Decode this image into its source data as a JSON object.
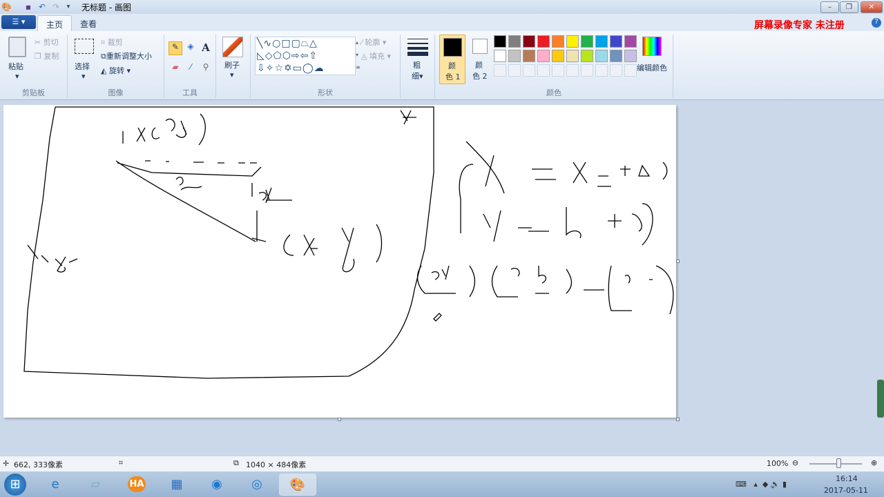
{
  "window": {
    "title": "无标题 - 画图",
    "watermark": "屏幕录像专家  未注册"
  },
  "tabs": [
    {
      "label": "主页",
      "active": true
    },
    {
      "label": "查看",
      "active": false
    }
  ],
  "ribbon": {
    "clipboard": {
      "paste": "粘贴",
      "cut": "剪切",
      "copy": "复制",
      "group": "剪贴板"
    },
    "image": {
      "select": "选择",
      "crop": "裁剪",
      "resize": "重新调整大小",
      "rotate": "旋转",
      "group": "图像"
    },
    "tools": {
      "group": "工具",
      "text_glyph": "A"
    },
    "brush": {
      "label": "刷子"
    },
    "shapes": {
      "outline": "轮廓",
      "fill": "填充",
      "group": "形状"
    },
    "size": {
      "label1": "粗",
      "label2": "细"
    },
    "colors": {
      "color1_a": "颜",
      "color1_b": "色 1",
      "color2_a": "颜",
      "color2_b": "色 2",
      "edit": "编辑颜色",
      "group": "颜色",
      "color1": "#000000",
      "color2": "#ffffff",
      "palette": [
        "#000000",
        "#7f7f7f",
        "#880015",
        "#ed1c24",
        "#ff7f27",
        "#fff200",
        "#22b14c",
        "#00a2e8",
        "#3f48cc",
        "#a349a4",
        "#ffffff",
        "#c3c3c3",
        "#b97a57",
        "#ffaec9",
        "#ffc90e",
        "#efe4b0",
        "#b5e61d",
        "#99d9ea",
        "#7092be",
        "#c8bfe7"
      ]
    }
  },
  "status": {
    "cursor": "662, 333像素",
    "canvas_size": "1040 × 484像素",
    "zoom": "100%",
    "zoom_fraction": 0.5
  },
  "taskbar": {
    "time": "16:14",
    "date": "2017-05-11"
  }
}
